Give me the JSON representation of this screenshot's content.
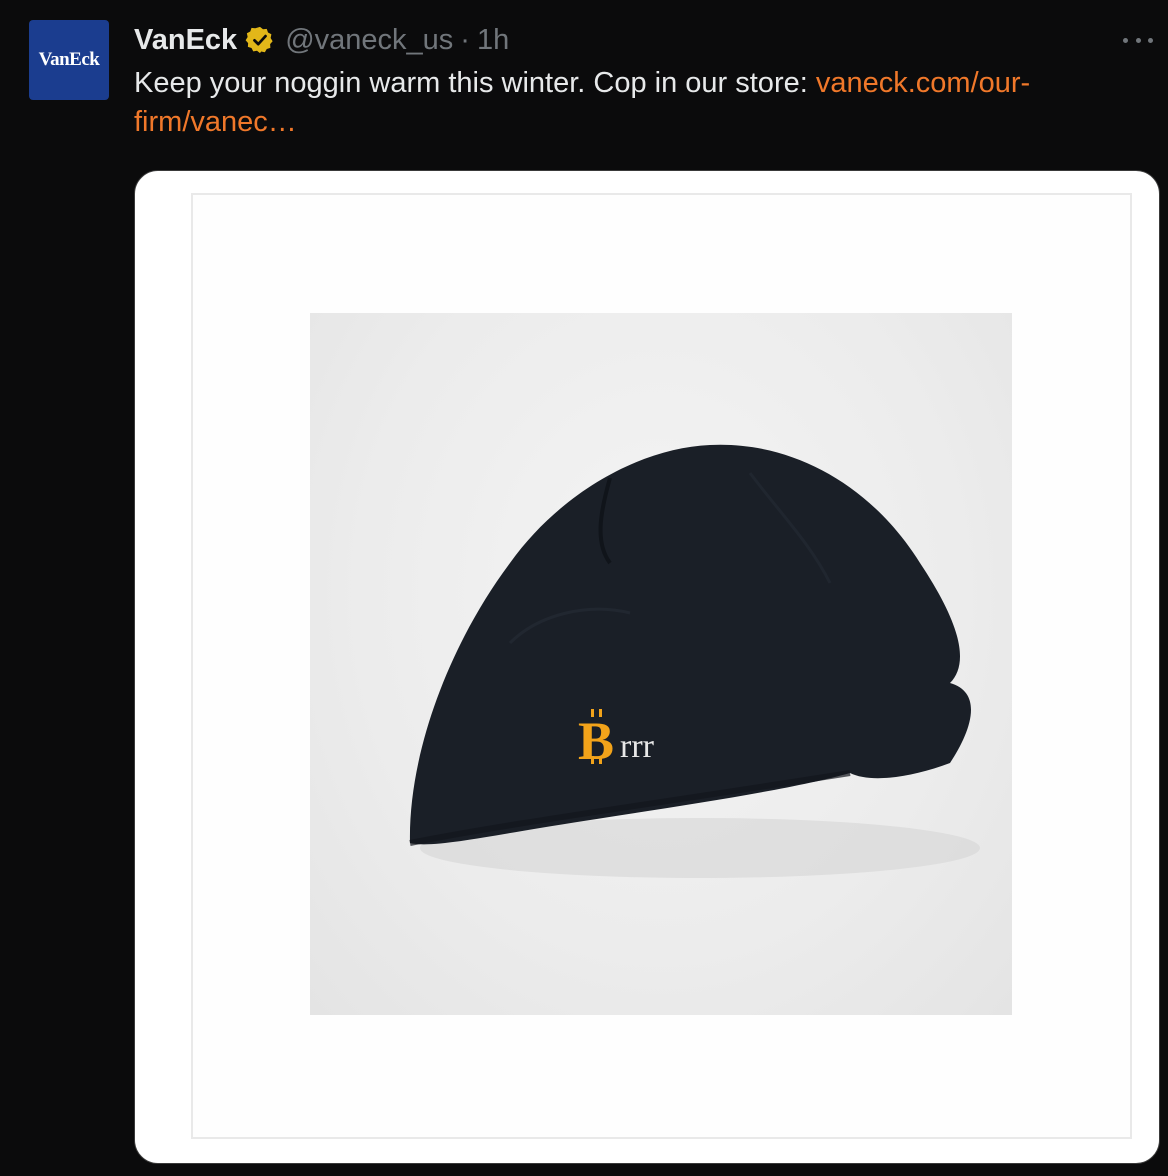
{
  "account": {
    "avatar_text": "VanEck",
    "display_name": "VanEck",
    "handle": "@vaneck_us",
    "separator": "·",
    "time": "1h"
  },
  "icons": {
    "verified": "verified-badge-icon",
    "more": "more-options-icon"
  },
  "tweet": {
    "text": "Keep your noggin warm this winter. Cop in our store: ",
    "link": "vaneck.com/our-firm/vanec…"
  },
  "media": {
    "embroidery": "rrr",
    "embroidery_symbol": "B"
  },
  "colors": {
    "background": "#0b0b0c",
    "text": "#e7e9ea",
    "muted": "#71767b",
    "link": "#f0782a",
    "verified_badge": "#e2b719",
    "avatar": "#1b3d8f",
    "beanie": "#1a1f27",
    "bitcoin_orange": "#f2a31a"
  }
}
